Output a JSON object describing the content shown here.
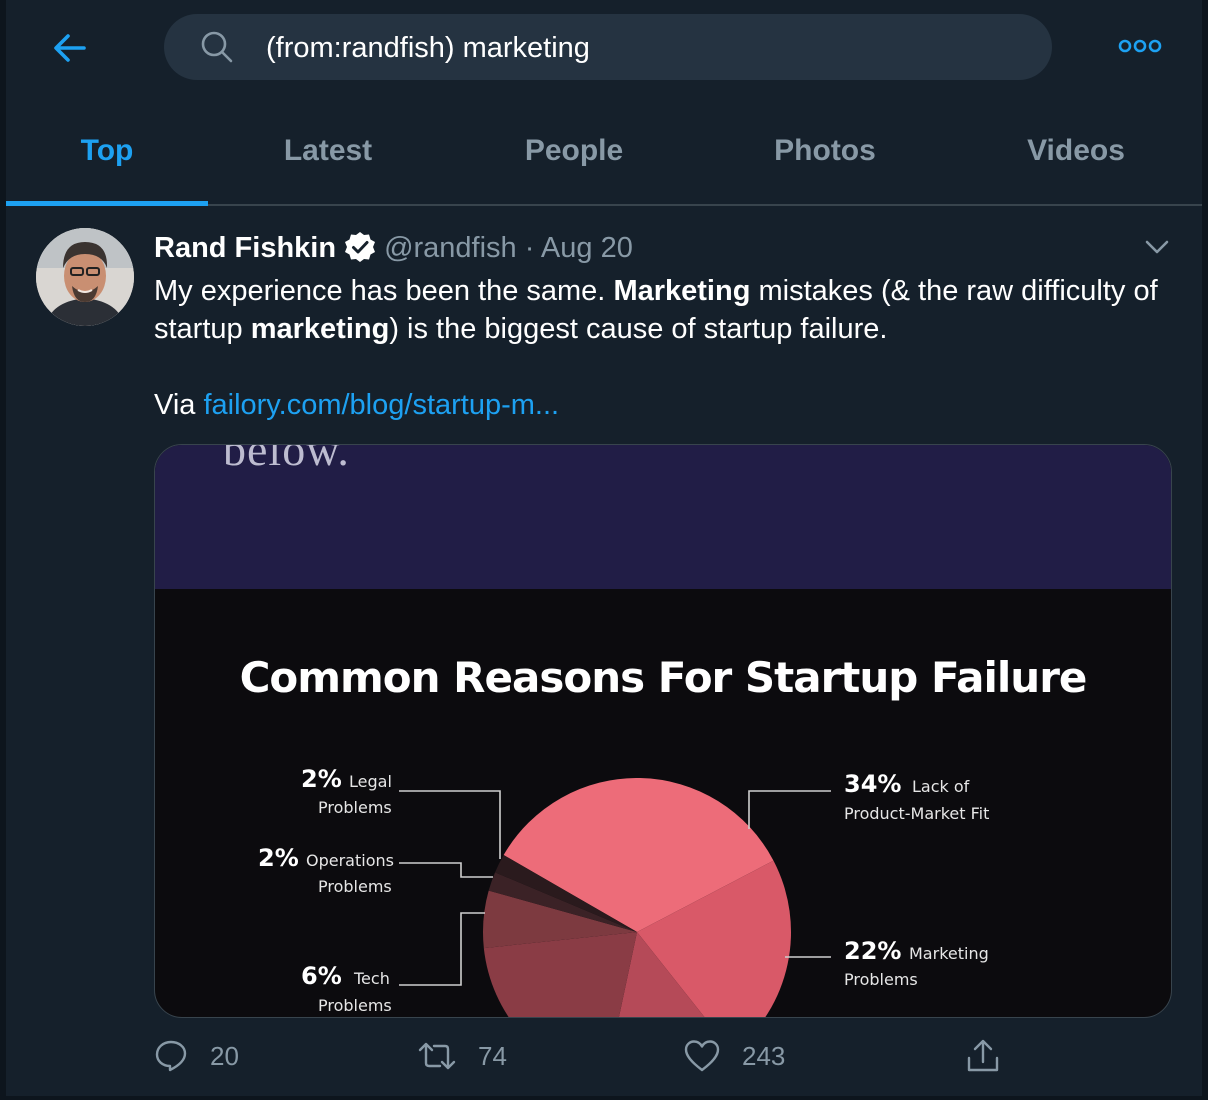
{
  "search": {
    "query": "(from:randfish) marketing"
  },
  "tabs": [
    {
      "label": "Top",
      "active": true
    },
    {
      "label": "Latest",
      "active": false
    },
    {
      "label": "People",
      "active": false
    },
    {
      "label": "Photos",
      "active": false
    },
    {
      "label": "Videos",
      "active": false
    }
  ],
  "tweet": {
    "author_name": "Rand Fishkin",
    "handle": "@randfish",
    "separator": "·",
    "date": "Aug 20",
    "text": {
      "p1_a": "My experience has been the same. ",
      "p1_b": "Marketing",
      "p1_c": " mistakes (& the raw difficulty of startup ",
      "p1_d": "marketing",
      "p1_e": ") is the biggest cause of startup failure.",
      "via": "Via ",
      "link": "failory.com/blog/startup-m..."
    },
    "media": {
      "top_text": "below.",
      "title": "Common Reasons For Startup Failure",
      "labels": [
        {
          "pct": "2%",
          "line1": "Legal",
          "line2": "Problems"
        },
        {
          "pct": "2%",
          "line1": "Operations",
          "line2": "Problems"
        },
        {
          "pct": "6%",
          "line1": "Tech",
          "line2": "Problems"
        },
        {
          "pct": "34%",
          "line1": "Lack of",
          "line2": "Product-Market Fit"
        },
        {
          "pct": "22%",
          "line1": "Marketing",
          "line2": "Problems"
        }
      ]
    },
    "actions": {
      "replies": "20",
      "retweets": "74",
      "likes": "243"
    }
  },
  "colors": {
    "background": "#15202b",
    "accent": "#1da1f2",
    "muted": "#8899a6",
    "pie_main": "#e96b77"
  },
  "chart_data": {
    "type": "pie",
    "title": "Common Reasons For Startup Failure",
    "categories": [
      "Lack of Product-Market Fit",
      "Marketing Problems",
      "Tech Problems",
      "Operations Problems",
      "Legal Problems"
    ],
    "values": [
      34,
      22,
      6,
      2,
      2
    ]
  }
}
